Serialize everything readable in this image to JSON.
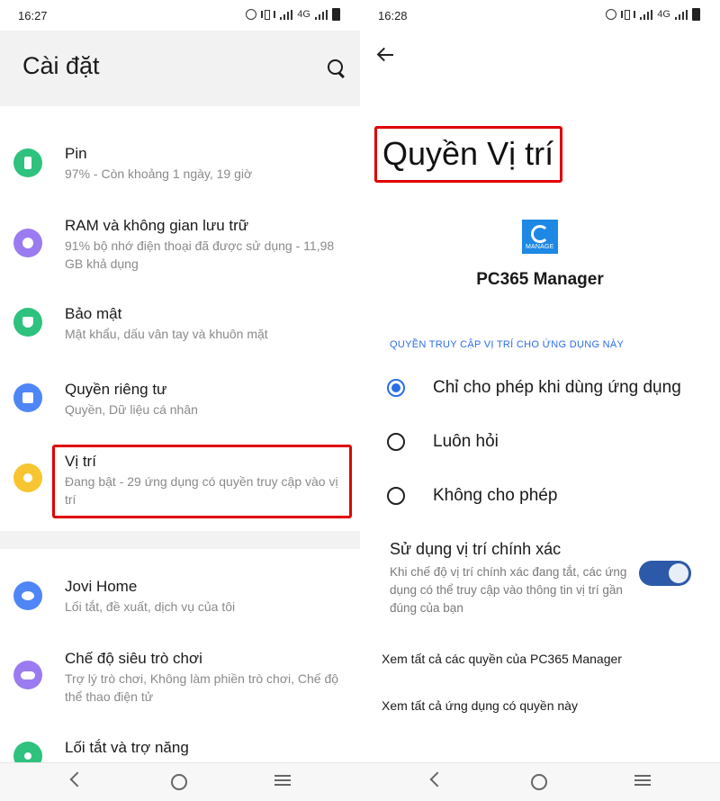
{
  "left": {
    "status": {
      "time": "16:27",
      "network": "4G"
    },
    "title": "Cài đặt",
    "items": [
      {
        "title": "Pin",
        "subtitle": "97% - Còn khoảng 1 ngày, 19 giờ",
        "icon": "battery-icon",
        "color": "#2ec27e"
      },
      {
        "title": "RAM và không gian lưu trữ",
        "subtitle": "91% bộ nhớ điện thoại đã được sử dụng - 11,98 GB khả dụng",
        "icon": "storage-icon",
        "color": "#9b7cf0"
      },
      {
        "title": "Bảo mật",
        "subtitle": "Mật khẩu, dấu vân tay và khuôn mặt",
        "icon": "shield-icon",
        "color": "#2ec27e"
      },
      {
        "title": "Quyền riêng tư",
        "subtitle": "Quyền, Dữ liệu cá nhân",
        "icon": "lock-icon",
        "color": "#4f86f7"
      },
      {
        "title": "Vị trí",
        "subtitle": "Đang bật - 29 ứng dụng có quyền truy cập vào vị trí",
        "icon": "location-icon",
        "color": "#f7c531"
      },
      {
        "title": "Jovi Home",
        "subtitle": "Lối tắt, đề xuất, dịch vụ của tôi",
        "icon": "jovi-icon",
        "color": "#4f86f7"
      },
      {
        "title": "Chế độ siêu trò chơi",
        "subtitle": "Trợ lý trò chơi, Không làm phiền trò chơi, Chế độ thể thao điện tử",
        "icon": "gamepad-icon",
        "color": "#9b7cf0"
      },
      {
        "title": "Lối tắt và trợ năng",
        "subtitle": "",
        "icon": "accessibility-icon",
        "color": "#2ec27e"
      }
    ]
  },
  "right": {
    "status": {
      "time": "16:28",
      "network": "4G"
    },
    "title": "Quyền Vị trí",
    "app_name": "PC365 Manager",
    "app_logo_text": "MANAGE",
    "section_header": "QUYỀN TRUY CẬP VỊ TRÍ CHO ỨNG DỤNG NÀY",
    "options": [
      {
        "label": "Chỉ cho phép khi dùng ứng dụng",
        "selected": true
      },
      {
        "label": "Luôn hỏi",
        "selected": false
      },
      {
        "label": "Không cho phép",
        "selected": false
      }
    ],
    "precise": {
      "title": "Sử dụng vị trí chính xác",
      "description": "Khi chế độ vị trí chính xác đang tắt, các ứng dụng có thể truy cập vào thông tin vị trí gần đúng của bạn",
      "enabled": true
    },
    "links": [
      "Xem tất cả các quyền của PC365 Manager",
      "Xem tất cả ứng dụng có quyền này"
    ]
  },
  "colors": {
    "accent": "#2a6ee6",
    "highlight": "#e00000",
    "toggle": "#2d5aa8"
  }
}
